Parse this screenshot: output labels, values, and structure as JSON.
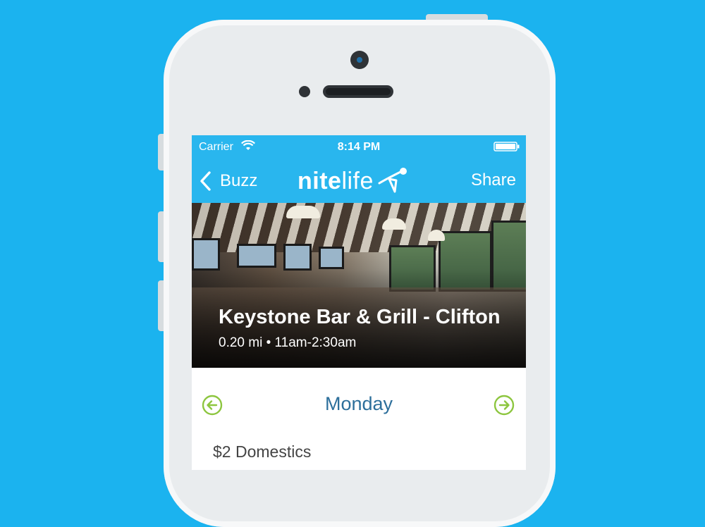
{
  "status_bar": {
    "carrier": "Carrier",
    "time": "8:14 PM"
  },
  "nav": {
    "back_label": "Buzz",
    "logo_bold": "nite",
    "logo_light": "life",
    "share_label": "Share"
  },
  "venue": {
    "name": "Keystone Bar & Grill - Clifton",
    "details": "0.20 mi • 11am-2:30am"
  },
  "schedule": {
    "day": "Monday"
  },
  "deals": [
    "$2 Domestics"
  ],
  "colors": {
    "background": "#1bb3ef",
    "bar": "#29b6ee",
    "accent_green": "#8dc63f",
    "day_text": "#2d6f9b"
  }
}
